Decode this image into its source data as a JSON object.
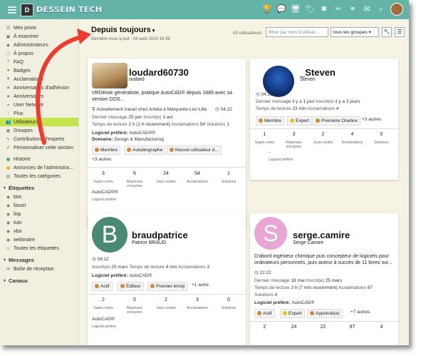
{
  "brand": "DESSEIN TECH",
  "logo_letter": "D",
  "top_icons": [
    "trophy-icon",
    "chat-icon",
    "monitor-icon",
    "tag-icon",
    "bug-icon",
    "wrench-icon",
    "network-icon",
    "bell-icon",
    "search-icon"
  ],
  "sidebar": {
    "items": [
      {
        "icon": "list-icon",
        "label": "Mes posts"
      },
      {
        "icon": "inbox-icon",
        "label": "À examiner"
      },
      {
        "icon": "shield-icon",
        "label": "Administrateurs"
      },
      {
        "icon": "info-icon",
        "label": "À propos"
      },
      {
        "icon": "question-icon",
        "label": "FAQ"
      },
      {
        "icon": "badge-icon",
        "label": "Badges"
      },
      {
        "icon": "heart-icon",
        "label": "Acclamations"
      },
      {
        "icon": "cake-icon",
        "label": "Anniversaires d'adhésion"
      },
      {
        "icon": "cake-icon",
        "label": "Anniversaires"
      },
      {
        "icon": "network-icon",
        "label": "User Network"
      },
      {
        "icon": "chevron-icon",
        "label": "Plus"
      },
      {
        "icon": "users-icon",
        "label": "Utilisateurs",
        "active": true
      },
      {
        "icon": "group-icon",
        "label": "Groupes"
      },
      {
        "icon": "pen-icon",
        "label": "Contributions d'experts"
      },
      {
        "icon": "pencil-icon",
        "label": "Personnaliser cette section"
      }
    ],
    "categories": [
      {
        "label": "Histoire",
        "color": "#55a85f"
      },
      {
        "label": "Annonces de l'administra...",
        "color": "#f2b705"
      },
      {
        "label": "Toutes les catégories",
        "icon": "grid-icon"
      }
    ],
    "tags_heading": "Étiquettes",
    "tags": [
      "bim",
      "favori",
      "lisp",
      "tuto",
      "vba",
      "webinaire",
      "Toutes les étiquettes"
    ],
    "messages_heading": "Messages",
    "messages_items": [
      "Boîte de réception"
    ],
    "channels_heading": "Canaux"
  },
  "header": {
    "title": "Depuis toujours",
    "subtitle": "Dernière mise à jour : 04 août 2024 16:39",
    "count": "63 utilisateurs",
    "filter_placeholder": "filtrer par nom d'utilisat...",
    "groups_select": "tous les groupes"
  },
  "stat_labels": [
    "Sujets créés",
    "Réponses envoyées",
    "Jours visités",
    "Acclamations",
    "Solutions"
  ],
  "cards": [
    {
      "username": "loudard60730",
      "realname": "oudard",
      "bio": "VRDéiste généraliste, pratique AutoCAD® depuis 1889 avec sa version DOS...",
      "location": "Actuellement travail chez Artelia à Marquette-Lez-Lille",
      "localtime": "04:22",
      "last_message_label": "Dernier message",
      "last_message": "25 juin",
      "joined_label": "Inscrit(e)",
      "joined": "3 avr.",
      "reading_label": "Temps de lecture",
      "reading": "2 h (1 h récemment)",
      "acclaim_label": "Acclamations",
      "acclaim": "54",
      "solutions_label": "Solutions",
      "solutions": "1",
      "software_label": "Logiciel préféré:",
      "software": "AutoCAD®®",
      "domain_label": "Domaine:",
      "domain": "Design & Manufacturing",
      "badges": [
        "Membre",
        "Autobiographe",
        "Nouvel utilisateur d..."
      ],
      "more": "+3 autres",
      "stats": [
        "3",
        "6",
        "24",
        "54",
        "1"
      ],
      "footer_value": "AutoCAD®®",
      "footer_label": "Logiciel préféré"
    },
    {
      "username": "_Steven",
      "realname": "Steven",
      "localtime": "04:22",
      "last_message_label": "Dernier message",
      "last_message": "il y a 1 jour",
      "joined_label": "Inscrit(e)",
      "joined": "il y a 3 jours",
      "reading_label": "Temps de lecture",
      "reading": "23 min",
      "acclaim_label": "Acclamations",
      "acclaim": "4",
      "badges": [
        "Membre",
        "Expert",
        "Première Onebox"
      ],
      "more": "+3 autres",
      "stats": [
        "1",
        "3",
        "2",
        "4",
        "0"
      ],
      "footer_value": "-",
      "footer_label": "Logiciel préféré"
    },
    {
      "username": "braudpatrice",
      "realname": "Patrice BRAUD",
      "avatar_letter": "B",
      "localtime": "04:22",
      "joined_label": "Inscrit(e)",
      "joined": "25 mars",
      "reading_label": "Temps de lecture",
      "reading": "4 min",
      "acclaim_label": "Acclamations",
      "acclaim": "3",
      "software_label": "Logiciel préféré:",
      "software": "AutoCAD®",
      "badges": [
        "Actif",
        "Éditeur",
        "Premier émoji"
      ],
      "more": "+1 autre",
      "stats": [
        "2",
        "0",
        "2",
        "3",
        "0"
      ],
      "footer_value": "AutoCAD®",
      "footer_label": "Logiciel préféré"
    },
    {
      "username": "serge.camire",
      "realname": "Serge Camire",
      "avatar_letter": "S",
      "bio": "D'abord ingénieur chimique puis concepteur de logiciels pour ordinateurs personnels, puis auteur à succès de 11 livres sur...",
      "localtime": "22:22",
      "last_message_label": "Dernier message",
      "last_message": "18 mai",
      "joined_label": "Inscrit(e)",
      "joined": "25 mars",
      "reading_label": "Temps de lecture",
      "reading": "3 h (7 min récemment)",
      "acclaim_label": "Acclamations",
      "acclaim": "87",
      "solutions_label": "Solutions",
      "solutions": "4",
      "software_label": "Logiciel préféré:",
      "software": "AutoCAD®",
      "badges": [
        "Actif",
        "Expert",
        "Apprécié(e)"
      ],
      "more": "+7 autres",
      "stats": [
        "2",
        "24",
        "22",
        "87",
        "4"
      ]
    }
  ]
}
